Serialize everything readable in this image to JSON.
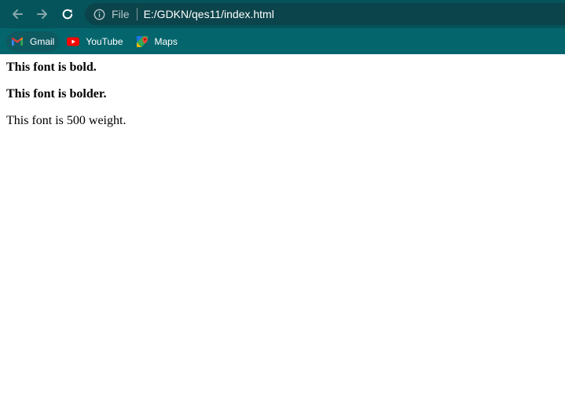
{
  "toolbar": {
    "back_icon": "arrow-left-icon",
    "forward_icon": "arrow-right-icon",
    "reload_icon": "reload-icon",
    "omnibox": {
      "info_icon": "info-icon",
      "scheme": "File",
      "url": "E:/GDKN/qes11/index.html"
    }
  },
  "bookmarks": {
    "items": [
      {
        "label": "Gmail",
        "icon": "gmail-icon"
      },
      {
        "label": "YouTube",
        "icon": "youtube-icon"
      },
      {
        "label": "Maps",
        "icon": "maps-icon"
      }
    ]
  },
  "page": {
    "lines": [
      "This font is bold.",
      "This font is bolder.",
      "This font is 500 weight."
    ]
  },
  "colors": {
    "toolbar_bg": "#05545c",
    "omnibox_bg": "#0c444b",
    "bookmarks_bg": "#05656d",
    "page_bg": "#ffffff"
  }
}
